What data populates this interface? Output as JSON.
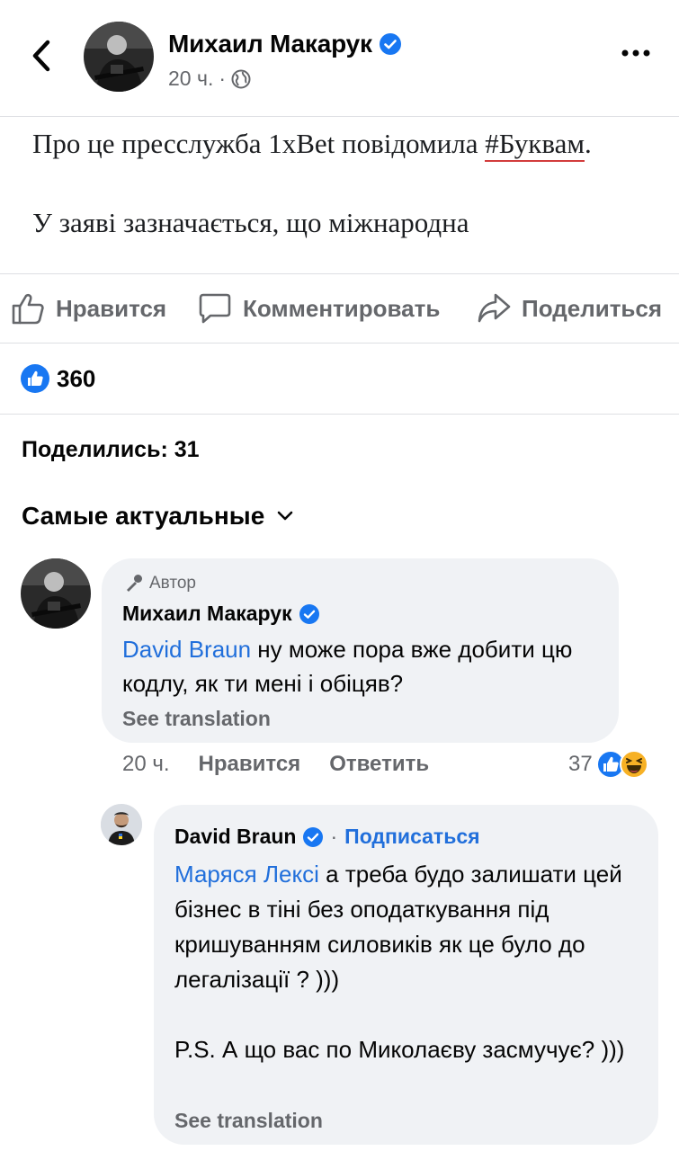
{
  "header": {
    "back_icon": "chevron-left-icon",
    "name": "Михаил Макарук",
    "verified_icon": "verified-badge-icon",
    "time": "20 ч.",
    "separator": "·",
    "privacy_icon": "globe-icon",
    "more_icon": "more-horizontal-icon"
  },
  "post": {
    "line1_before": "Про це пресслужба 1xBet повідомила ",
    "line1_hashtag": "#Буквам",
    "line1_after": ".",
    "line2": "У заяві зазначається, що міжнародна"
  },
  "actions": {
    "like_label": "Нравится",
    "comment_label": "Комментировать",
    "share_label": "Поделиться"
  },
  "reactions": {
    "like_count": "360"
  },
  "shares": {
    "label": "Поделились: 31"
  },
  "sort": {
    "label": "Самые актуальные"
  },
  "comments": [
    {
      "badge": "Автор",
      "author": "Михаил Макарук",
      "mention": "David Braun",
      "text": " ну може пора вже добити цю кодлу, як ти мені і обіцяв?",
      "see_translation": "See translation",
      "time": "20 ч.",
      "like_label": "Нравится",
      "reply_label": "Ответить",
      "reaction_count": "37"
    },
    {
      "author": "David Braun",
      "separator": "·",
      "follow_label": "Подписаться",
      "mention": "Маряся Лексі",
      "text": " а треба будо залишати цей бізнес в тіні без оподаткування під кришуванням силовиків як це було до легалізації ? )))",
      "ps": "P.S. А що вас по Миколаєву засмучує? )))",
      "see_translation": "See translation"
    }
  ],
  "colors": {
    "accent_blue": "#216fdb",
    "verified_blue": "#1877f2",
    "text_secondary": "#65676b",
    "bubble_bg": "#f0f2f5",
    "hashtag_underline": "#d23c3c"
  }
}
